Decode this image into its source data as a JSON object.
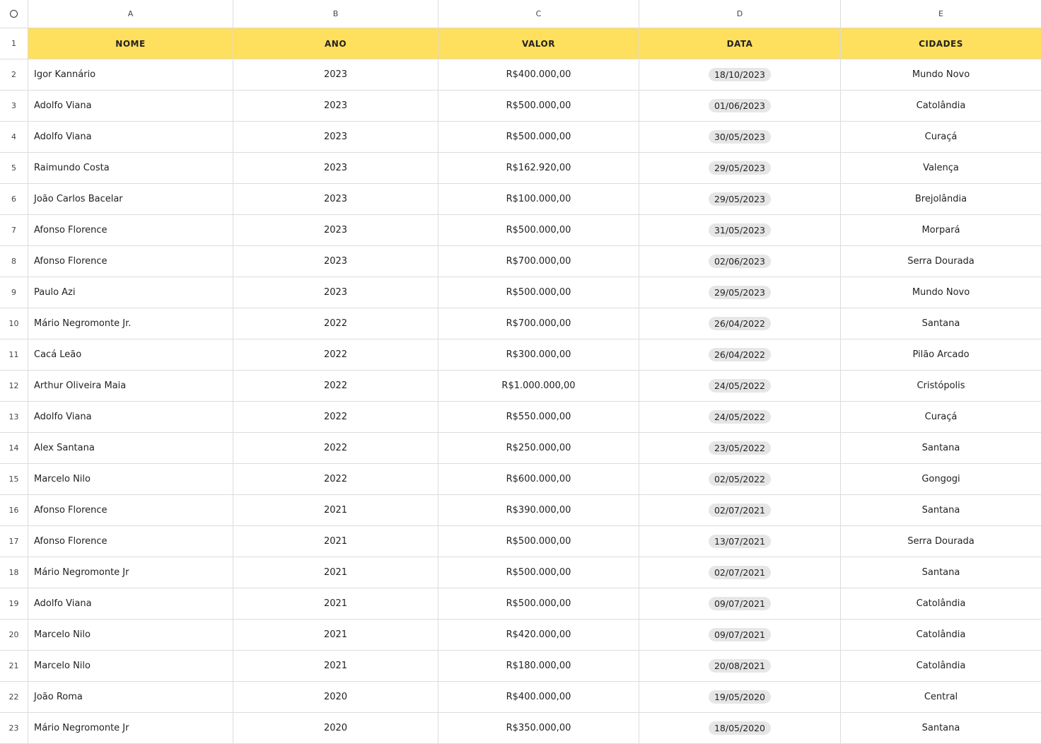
{
  "corner_icon": "select-all-circle-icon",
  "column_letters": [
    "A",
    "B",
    "C",
    "D",
    "E"
  ],
  "header": {
    "row_num": "1",
    "cells": [
      "NOME",
      "ANO",
      "VALOR",
      "DATA",
      "CIDADES"
    ]
  },
  "rows": [
    {
      "n": "2",
      "a": "Igor Kannário",
      "b": "2023",
      "c": "R$400.000,00",
      "d": "18/10/2023",
      "e": "Mundo Novo"
    },
    {
      "n": "3",
      "a": "Adolfo Viana",
      "b": "2023",
      "c": "R$500.000,00",
      "d": "01/06/2023",
      "e": "Catolândia"
    },
    {
      "n": "4",
      "a": "Adolfo Viana",
      "b": "2023",
      "c": "R$500.000,00",
      "d": "30/05/2023",
      "e": "Curaçá"
    },
    {
      "n": "5",
      "a": "Raimundo Costa",
      "b": "2023",
      "c": "R$162.920,00",
      "d": "29/05/2023",
      "e": "Valença"
    },
    {
      "n": "6",
      "a": "João Carlos Bacelar",
      "b": "2023",
      "c": "R$100.000,00",
      "d": "29/05/2023",
      "e": "Brejolândia"
    },
    {
      "n": "7",
      "a": "Afonso Florence",
      "b": "2023",
      "c": "R$500.000,00",
      "d": "31/05/2023",
      "e": "Morpará"
    },
    {
      "n": "8",
      "a": "Afonso Florence",
      "b": "2023",
      "c": "R$700.000,00",
      "d": "02/06/2023",
      "e": "Serra Dourada"
    },
    {
      "n": "9",
      "a": "Paulo Azi",
      "b": "2023",
      "c": "R$500.000,00",
      "d": "29/05/2023",
      "e": "Mundo Novo"
    },
    {
      "n": "10",
      "a": "Mário Negromonte Jr.",
      "b": "2022",
      "c": "R$700.000,00",
      "d": "26/04/2022",
      "e": "Santana"
    },
    {
      "n": "11",
      "a": "Cacá Leão",
      "b": "2022",
      "c": "R$300.000,00",
      "d": "26/04/2022",
      "e": "Pilão Arcado"
    },
    {
      "n": "12",
      "a": "Arthur Oliveira Maia",
      "b": "2022",
      "c": "R$1.000.000,00",
      "d": "24/05/2022",
      "e": "Cristópolis"
    },
    {
      "n": "13",
      "a": "Adolfo Viana",
      "b": "2022",
      "c": "R$550.000,00",
      "d": "24/05/2022",
      "e": "Curaçá"
    },
    {
      "n": "14",
      "a": "Alex Santana",
      "b": "2022",
      "c": "R$250.000,00",
      "d": "23/05/2022",
      "e": "Santana"
    },
    {
      "n": "15",
      "a": "Marcelo Nilo",
      "b": "2022",
      "c": "R$600.000,00",
      "d": "02/05/2022",
      "e": "Gongogi"
    },
    {
      "n": "16",
      "a": "Afonso Florence",
      "b": "2021",
      "c": "R$390.000,00",
      "d": "02/07/2021",
      "e": "Santana"
    },
    {
      "n": "17",
      "a": "Afonso Florence",
      "b": "2021",
      "c": "R$500.000,00",
      "d": "13/07/2021",
      "e": "Serra Dourada"
    },
    {
      "n": "18",
      "a": "Mário Negromonte Jr",
      "b": "2021",
      "c": "R$500.000,00",
      "d": "02/07/2021",
      "e": "Santana"
    },
    {
      "n": "19",
      "a": "Adolfo Viana",
      "b": "2021",
      "c": "R$500.000,00",
      "d": "09/07/2021",
      "e": "Catolândia"
    },
    {
      "n": "20",
      "a": "Marcelo Nilo",
      "b": "2021",
      "c": "R$420.000,00",
      "d": "09/07/2021",
      "e": "Catolândia"
    },
    {
      "n": "21",
      "a": "Marcelo Nilo",
      "b": "2021",
      "c": "R$180.000,00",
      "d": "20/08/2021",
      "e": "Catolândia"
    },
    {
      "n": "22",
      "a": "João Roma",
      "b": "2020",
      "c": "R$400.000,00",
      "d": "19/05/2020",
      "e": "Central"
    },
    {
      "n": "23",
      "a": "Mário Negromonte Jr",
      "b": "2020",
      "c": "R$350.000,00",
      "d": "18/05/2020",
      "e": "Santana"
    }
  ]
}
